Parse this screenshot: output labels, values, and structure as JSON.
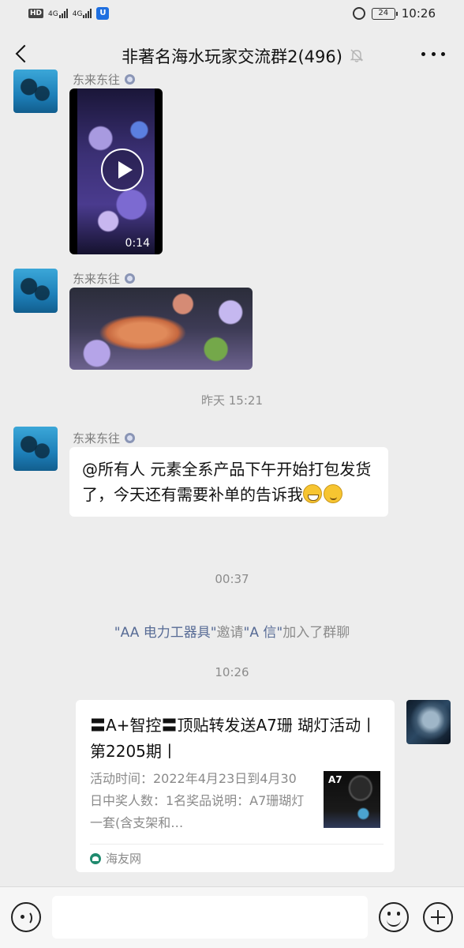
{
  "status_bar": {
    "hd_label": "HD",
    "sim1_network": "4G",
    "sim2_network": "4G",
    "battery_level": "24",
    "time": "10:26"
  },
  "header": {
    "back_icon": "chevron-left-icon",
    "title": "非著名海水玩家交流群2(496)",
    "mute_icon": "bell-off-icon",
    "more_icon": "more-horizontal-icon"
  },
  "messages": [
    {
      "type": "video",
      "sender": "东来东往",
      "duration": "0:14"
    },
    {
      "type": "image",
      "sender": "东来东往"
    },
    {
      "type": "timestamp",
      "text": "昨天 15:21"
    },
    {
      "type": "text",
      "sender": "东来东往",
      "text": "@所有人  元素全系产品下午开始打包发货了，今天还有需要补单的告诉我"
    },
    {
      "type": "timestamp",
      "text": "00:37"
    },
    {
      "type": "system",
      "inviter": "\"AA 电力工器具\"",
      "verb": "邀请",
      "invitee": "\"A 信\"",
      "suffix": "加入了群聊"
    },
    {
      "type": "timestamp",
      "text": "10:26"
    },
    {
      "type": "link_card",
      "sender": "self",
      "title": "〓A+智控〓顶贴转发送A7珊 瑚灯活动丨第2205期丨",
      "description": "活动时间：2022年4月23日到4月30日中奖人数：1名奖品说明：A7珊瑚灯一套(含支架和…",
      "thumb_label": "A7",
      "source": "海友网"
    }
  ],
  "input_bar": {
    "voice_icon": "voice-icon",
    "emoji_icon": "emoji-icon",
    "plus_icon": "plus-icon",
    "input_value": ""
  }
}
